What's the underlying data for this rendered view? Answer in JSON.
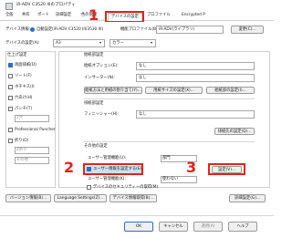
{
  "window": {
    "title": "iR-ADV C3520 IIIのプロパティ"
  },
  "tabs": [
    {
      "label": "全般"
    },
    {
      "label": "共有"
    },
    {
      "label": "ポート"
    },
    {
      "label": "詳細設定"
    },
    {
      "label": "色の管理"
    },
    {
      "label": "デバイスの設定"
    },
    {
      "label": "プロファイル"
    },
    {
      "label": "Encrypted P"
    }
  ],
  "top": {
    "device_info_label": "デバイス情報:",
    "auto_set_label": "自動設定(iR-ADV C3520 III/3530 III)",
    "profile_label": "機能プロファイル(B):",
    "profile_value": "iR-ADV(ライブラリ)",
    "change_button": "変更(C)..."
  },
  "device_settings": {
    "label": "デバイスの設定(A):",
    "value": "A3",
    "color_value": "カラー"
  },
  "left_panel": {
    "header": "仕上げ設定",
    "items": [
      {
        "label": "両面排紙(D)",
        "state": "on"
      },
      {
        "label": "ソート(F)",
        "state": "off"
      },
      {
        "label": "ホチキス(I)",
        "state": "off"
      },
      {
        "label": "穴あけ(H)",
        "state": "off"
      },
      {
        "label": "パンチ(T)",
        "state": "off"
      },
      {
        "label": "2穴",
        "state": "disabled"
      },
      {
        "label": "Professional Puncher",
        "state": "off"
      },
      {
        "label": "折り(O)",
        "state": "off"
      },
      {
        "label": "Z折り",
        "state": "disabled"
      },
      {
        "label": "その他",
        "state": "disabled"
      }
    ]
  },
  "right_panel": {
    "group1_header": "給紙部設定",
    "rows": [
      {
        "label": "給紙オプション(E):",
        "value": "なし"
      },
      {
        "label": "インサーター(N):",
        "value": "なし"
      }
    ],
    "btn_row": [
      "給紙方法と用紙の割り当て(Y)...",
      "用紙サイズの設定(X)...",
      "給紙部の設定(I)..."
    ],
    "group2_header": "排紙部設定",
    "finisher_label": "フィニッシャー(H):",
    "finisher_value": "なし",
    "output_btn": "排紙先の設定(Q)...",
    "group3_header": "その他の設定",
    "other_rows": [
      {
        "label": "ユーザー管理機能(U):",
        "value": "部門"
      },
      {
        "label": "ユーザー情報を設定する(E)",
        "value": ""
      },
      {
        "label": "ユーザー管理機能(K):",
        "value": "使わない"
      }
    ],
    "settings_btn": "設定(V)...",
    "security_label": "デバイスのセキュリティーの取得(M)"
  },
  "bottom": {
    "version_btn": "バージョン情報(B)...",
    "language_btn": "Language Settings(Z)...",
    "device_btn": "デバイス情報取得(B)...",
    "detail_btn": "詳細設定(G)..."
  },
  "footer": {
    "ok": "OK",
    "cancel": "キャンセル",
    "apply": "適用(A)",
    "help": "ヘルプ"
  },
  "annotations": [
    {
      "label": "1"
    },
    {
      "label": "2"
    },
    {
      "label": "3"
    }
  ],
  "colors": {
    "highlight": "#e2231a",
    "accent": "#2b6fc6"
  }
}
